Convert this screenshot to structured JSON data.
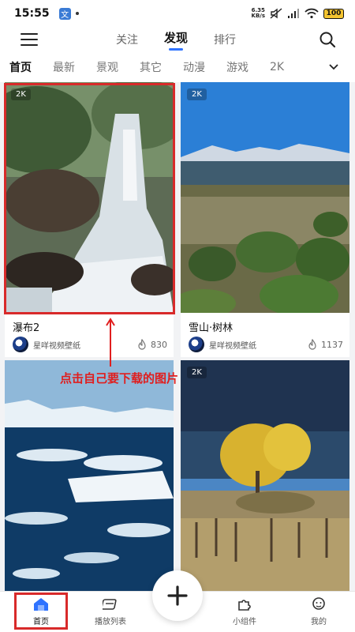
{
  "status_bar": {
    "time": "15:55",
    "app_badge": "文",
    "net_speed_value": "6.35",
    "net_speed_unit": "KB/s",
    "battery": "100"
  },
  "top_nav": {
    "tabs": [
      {
        "label": "关注",
        "active": false
      },
      {
        "label": "发现",
        "active": true
      },
      {
        "label": "排行",
        "active": false
      }
    ]
  },
  "categories": [
    "首页",
    "最新",
    "景观",
    "其它",
    "动漫",
    "游戏",
    "2K"
  ],
  "cards": [
    {
      "badge": "2K",
      "title": "瀑布2",
      "author": "星咩视频壁纸",
      "likes": "830"
    },
    {
      "badge": "2K",
      "title": "雪山·树林",
      "author": "星咩视频壁纸",
      "likes": "1137"
    },
    {
      "badge": "",
      "title": "",
      "author": "",
      "likes": ""
    },
    {
      "badge": "2K",
      "title": "",
      "author": "",
      "likes": ""
    }
  ],
  "annotation": "点击自己要下载的图片",
  "bottom_nav": [
    {
      "label": "首页",
      "icon": "home-icon",
      "active": true
    },
    {
      "label": "播放列表",
      "icon": "playlist-icon",
      "active": false
    },
    {
      "label": "小组件",
      "icon": "puzzle-icon",
      "active": false
    },
    {
      "label": "我的",
      "icon": "profile-icon",
      "active": false
    }
  ],
  "colors": {
    "accent": "#2f73ff",
    "highlight_box": "#d82a2a",
    "annotation_text": "#e01e1e"
  }
}
